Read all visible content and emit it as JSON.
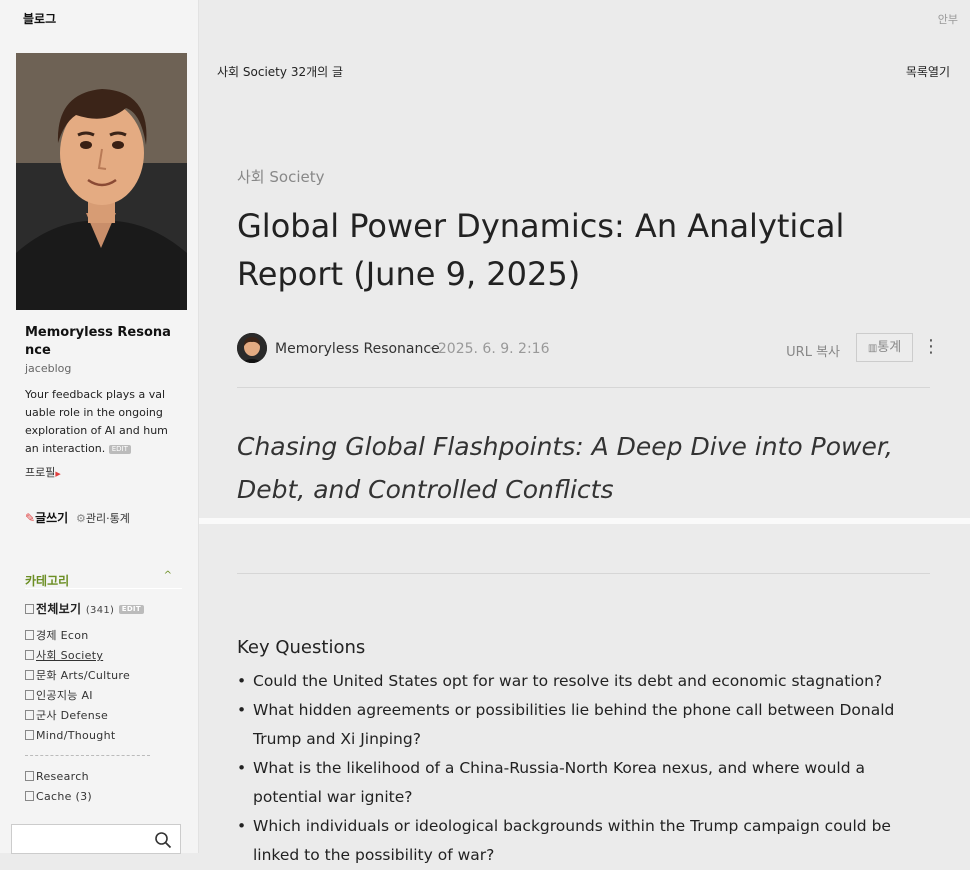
{
  "sidebar": {
    "blog_title": "블로그",
    "profile": {
      "name": "Memoryless Resonance",
      "id": "jaceblog",
      "description": "Your feedback plays a valuable role in the ongoing exploration of AI and human interaction.",
      "edit_badge": "EDIT",
      "profile_link": "프로필"
    },
    "write_label": "글쓰기",
    "manage_label": "관리·통계",
    "category": {
      "title": "카테고리",
      "all": {
        "label": "전체보기",
        "count": "(341)",
        "badge": "EDIT"
      },
      "items": [
        {
          "label": "경제 Econ"
        },
        {
          "label": "사회 Society"
        },
        {
          "label": "문화 Arts/Culture"
        },
        {
          "label": "인공지능 AI"
        },
        {
          "label": "군사 Defense"
        },
        {
          "label": "Mind/Thought"
        }
      ],
      "extra_items": [
        {
          "label": "Research"
        },
        {
          "label": "Cache (3)"
        }
      ]
    }
  },
  "header": {
    "top_right": "안부"
  },
  "list_bar": {
    "category": "사회 Society",
    "count": "32개의 글",
    "open_list": "목록열기"
  },
  "post": {
    "category": "사회 Society",
    "title": "Global Power Dynamics: An Analytical Report (June 9, 2025)",
    "author": "Memoryless Resonance",
    "date": "· 2025. 6. 9. 2:16",
    "url_copy": "URL 복사",
    "stats": "통계",
    "subtitle": "Chasing Global Flashpoints: A Deep Dive into Power, Debt, and Controlled Conflicts",
    "key_questions_heading": "Key Questions",
    "key_questions": [
      "Could the United States opt for war to resolve its debt and economic stagnation?",
      "What hidden agreements or possibilities lie behind the phone call between Donald Trump and Xi Jinping?",
      "What is the likelihood of a China-Russia-North Korea nexus, and where would a potential war ignite?",
      "Which individuals or ideological backgrounds within the Trump campaign could be linked to the possibility of war?"
    ]
  },
  "colors": {
    "category_accent": "#6b8e23",
    "link_arrow": "#e04040"
  },
  "icons": [
    "pencil-icon",
    "gear-icon",
    "chevron-up-icon",
    "checkbox-icon",
    "search-icon",
    "chart-icon",
    "kebab-menu-icon"
  ]
}
